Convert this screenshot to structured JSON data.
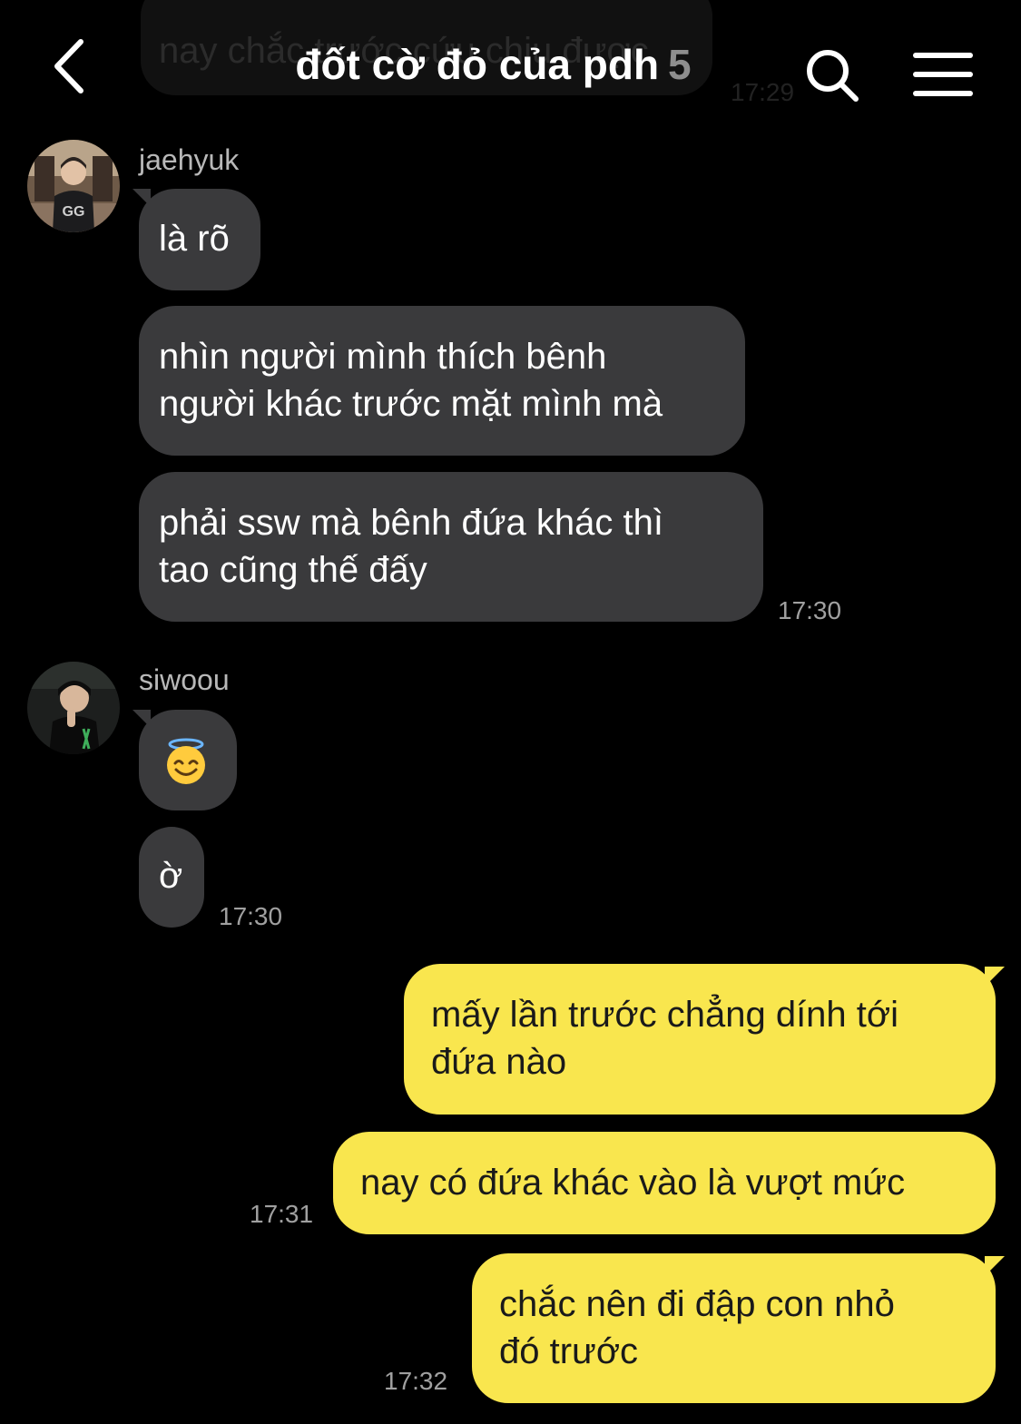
{
  "header": {
    "title": "đốt cờ đỏ của pdh",
    "member_count": "5",
    "background_preview_text": "nay chắc trước cứu chịu được",
    "background_preview_time": "17:29"
  },
  "messages": {
    "jaehyuk": {
      "name": "jaehyuk",
      "m1": "là rõ",
      "m2_line1": "nhìn người mình thích bênh",
      "m2_line2": "người khác trước mặt mình mà",
      "m3_line1": "phải ssw mà bênh đứa khác thì",
      "m3_line2": "tao cũng thế đấy",
      "time": "17:30"
    },
    "siwoou": {
      "name": "siwoou",
      "m1_emoji": "😇",
      "m2": "ờ",
      "time": "17:30"
    },
    "me": {
      "m1_line1": "mấy lần trước chẳng dính tới",
      "m1_line2": "đứa nào",
      "m2": "nay có đứa khác vào là vượt mức",
      "m2_time": "17:31",
      "m3_line1": "chắc nên đi đập con nhỏ",
      "m3_line2": "đó trước",
      "m3_time": "17:32"
    }
  },
  "colors": {
    "background": "#000000",
    "incoming_bubble": "#3a3a3c",
    "outgoing_bubble": "#f9e64e",
    "muted_text": "#a0a0a0"
  },
  "icons": [
    "back-icon",
    "search-icon",
    "menu-icon",
    "smiling-face-with-halo-emoji"
  ]
}
